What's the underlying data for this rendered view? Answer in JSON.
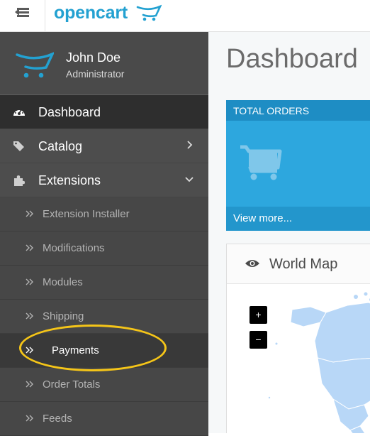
{
  "header": {
    "logo_text": "opencart"
  },
  "profile": {
    "name": "John Doe",
    "role": "Administrator"
  },
  "nav": {
    "dashboard": "Dashboard",
    "catalog": "Catalog",
    "extensions": "Extensions"
  },
  "extensions_menu": [
    {
      "label": "Extension Installer"
    },
    {
      "label": "Modifications"
    },
    {
      "label": "Modules"
    },
    {
      "label": "Shipping"
    },
    {
      "label": "Payments"
    },
    {
      "label": "Order Totals"
    },
    {
      "label": "Feeds"
    }
  ],
  "main": {
    "title": "Dashboard",
    "tile": {
      "title": "TOTAL ORDERS",
      "link": "View more..."
    },
    "map_panel": {
      "title": "World Map",
      "zoom_in": "+",
      "zoom_out": "−"
    }
  },
  "colors": {
    "brand_blue": "#23a1d1",
    "sidebar": "#515151",
    "tile_blue": "#2da7de",
    "highlight": "#f5c518",
    "map_land": "#b8d7f7"
  },
  "icons": {
    "menu_toggle": "sidebar-collapse-icon",
    "dashboard": "dashboard-gauge-icon",
    "catalog": "tags-icon",
    "extensions": "puzzle-icon",
    "tile": "shopping-cart-icon",
    "map": "eye-icon"
  }
}
